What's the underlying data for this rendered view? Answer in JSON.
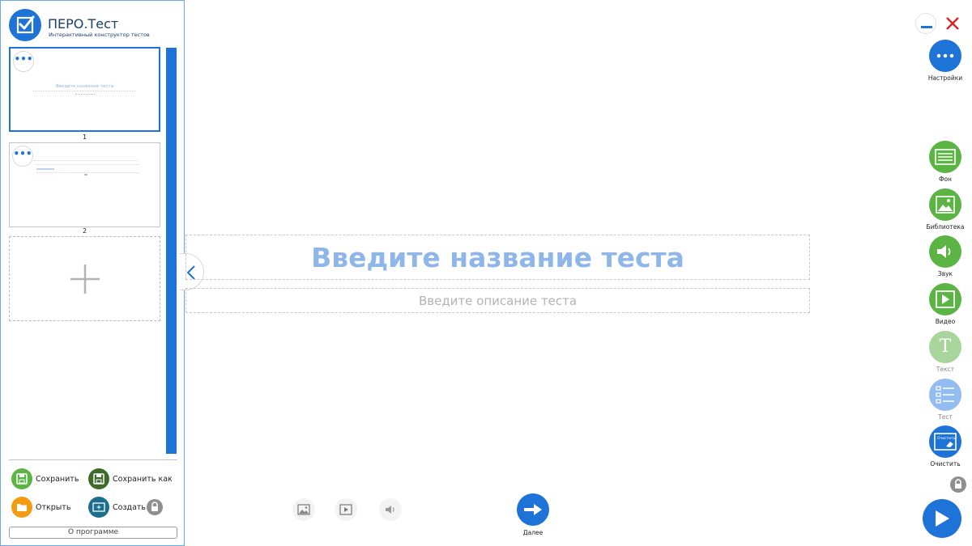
{
  "app": {
    "title": "ПЕРО.Тест",
    "subtitle": "Интерактивный конструктор тестов"
  },
  "slides": [
    {
      "number": "1",
      "preview_title": "Введите название теста",
      "active": true
    },
    {
      "number": "2",
      "active": false
    }
  ],
  "slide_menu_label": "•••",
  "file_actions": {
    "save": "Сохранить",
    "save_as": "Сохранить как",
    "open": "Открыть",
    "create": "Создать",
    "about": "О программе"
  },
  "editor": {
    "title_placeholder": "Введите название теста",
    "description_placeholder": "Введите описание теста"
  },
  "navigation": {
    "next": "Далее"
  },
  "tools": {
    "settings": "Настройки",
    "background": "Фон",
    "library": "Библиотека",
    "sound": "Звук",
    "video": "Видео",
    "text": "Текст",
    "test": "Тест",
    "clear": "Очистить",
    "clear_icon_text": "Очистить"
  },
  "colors": {
    "accent": "#1e73d8",
    "green": "#5bb443",
    "dark_green": "#3e6b2c",
    "orange": "#f39c12",
    "teal": "#1b6e8c",
    "disabled_green": "#a8d59b",
    "disabled_blue": "#93bdf0"
  },
  "icons": {
    "logo": "checkbox-icon",
    "add_slide": "plus-icon",
    "collapse": "chevron-left-icon",
    "image": "image-icon",
    "video": "play-icon",
    "sound": "speaker-icon",
    "next": "arrow-right-icon",
    "minimize": "minimize-icon",
    "close": "close-icon",
    "lock": "lock-icon",
    "play": "play-icon"
  }
}
